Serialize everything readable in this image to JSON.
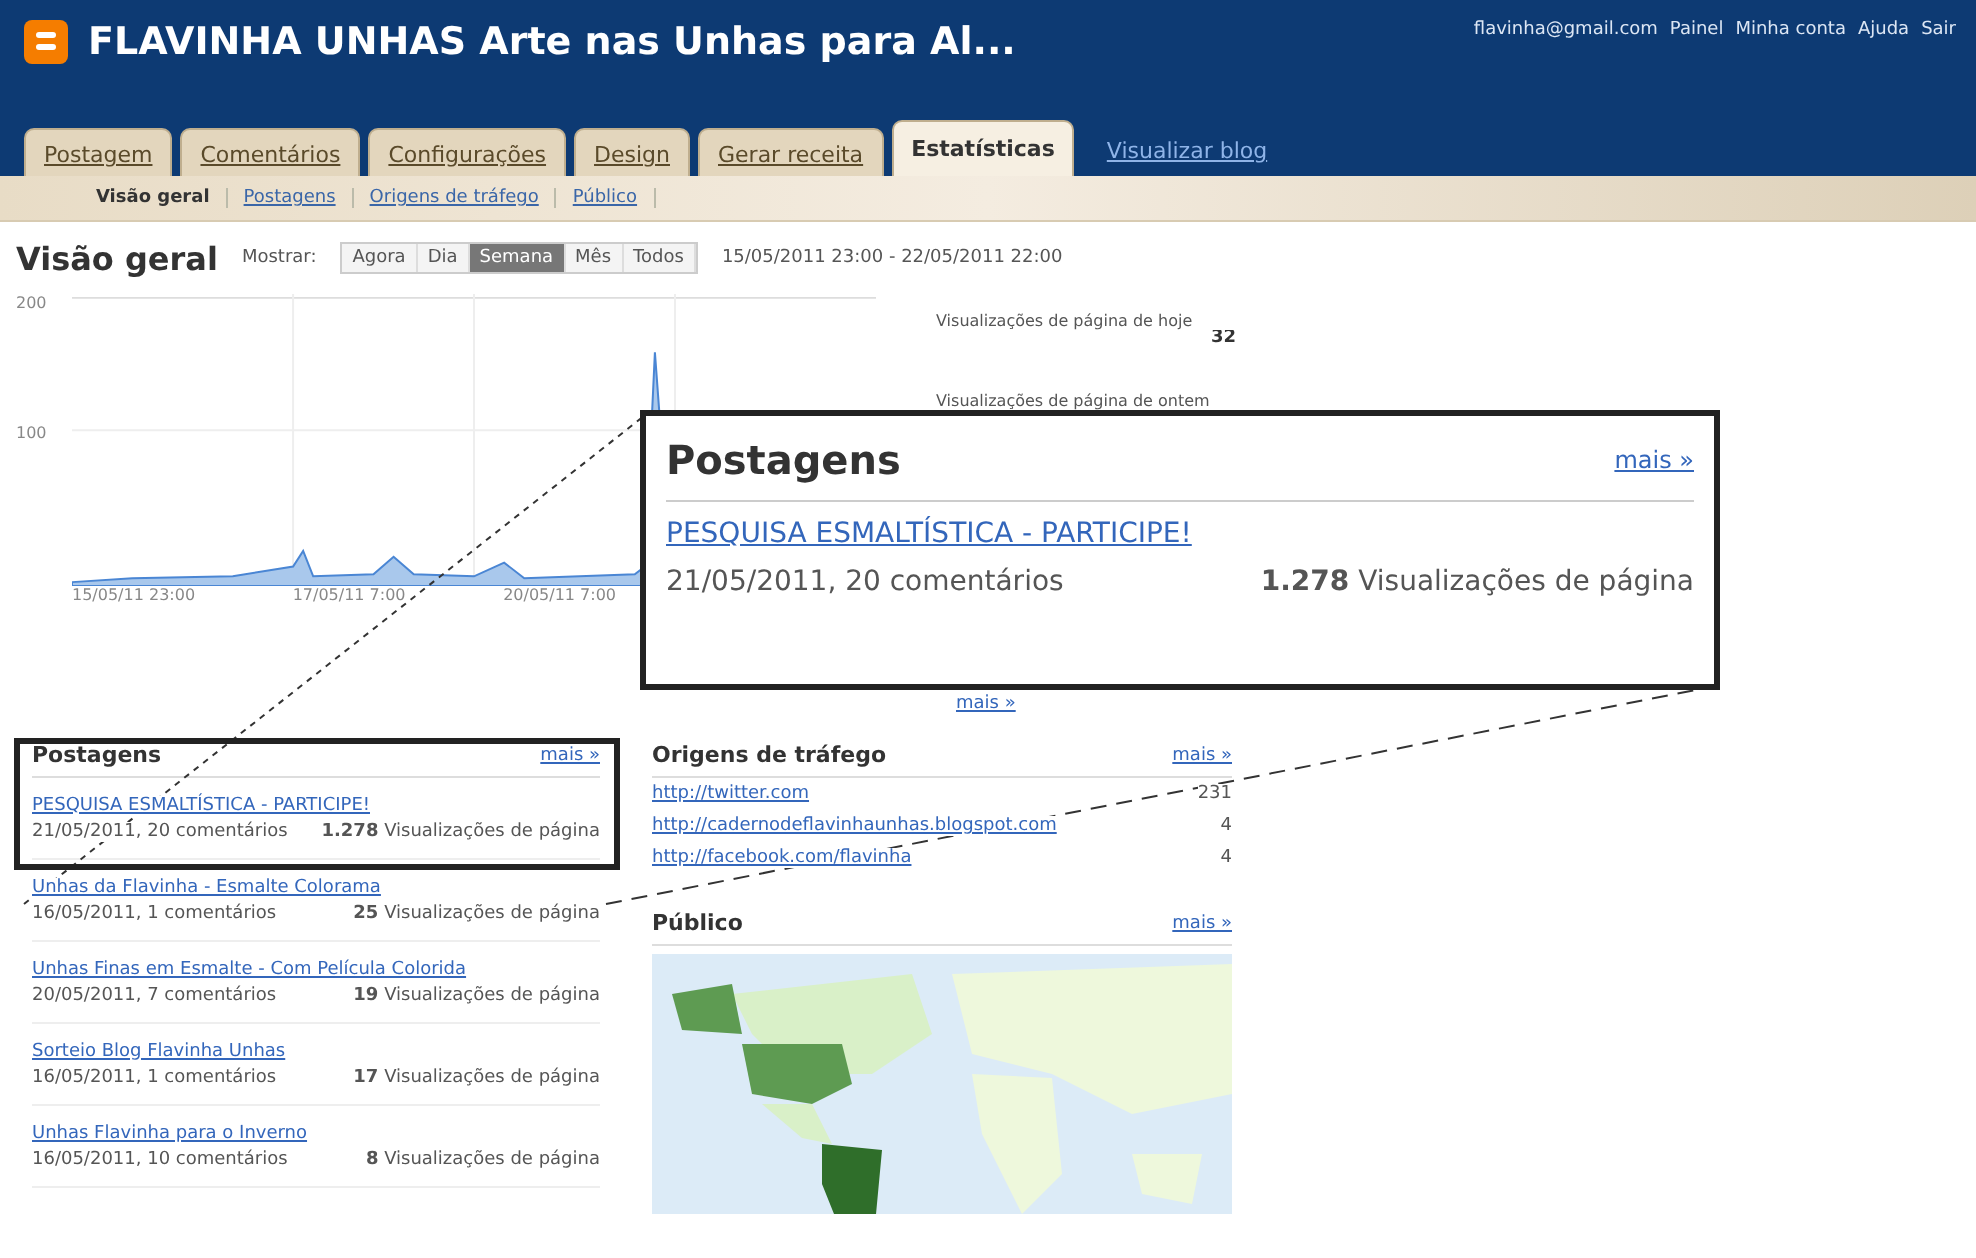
{
  "header": {
    "title": "FLAVINHA UNHAS Arte nas Unhas para Al...",
    "links": [
      "flavinha@gmail.com",
      "Painel",
      "Minha conta",
      "Ajuda",
      "Sair"
    ]
  },
  "tabs": [
    {
      "label": "Postagem",
      "selected": false
    },
    {
      "label": "Comentários",
      "selected": false
    },
    {
      "label": "Configurações",
      "selected": false
    },
    {
      "label": "Design",
      "selected": false
    },
    {
      "label": "Gerar receita",
      "selected": false
    },
    {
      "label": "Estatísticas",
      "selected": true
    }
  ],
  "view_blog_link": "Visualizar blog",
  "subtabs": [
    {
      "label": "Visão geral",
      "selected": true
    },
    {
      "label": "Postagens",
      "selected": false
    },
    {
      "label": "Origens de tráfego",
      "selected": false
    },
    {
      "label": "Público",
      "selected": false
    }
  ],
  "overview": {
    "title": "Visão geral",
    "show_label": "Mostrar:",
    "ranges": [
      {
        "label": "Agora",
        "selected": false
      },
      {
        "label": "Dia",
        "selected": false
      },
      {
        "label": "Semana",
        "selected": true
      },
      {
        "label": "Mês",
        "selected": false
      },
      {
        "label": "Todos",
        "selected": false
      }
    ],
    "date_range": "15/05/2011 23:00 - 22/05/2011 22:00"
  },
  "chart": {
    "y_labels": [
      "200",
      "100"
    ],
    "x_labels": [
      "15/05/11 23:00",
      "17/05/11 7:00",
      "20/05/11 7:00"
    ]
  },
  "stats": [
    {
      "label": "Visualizações de página de hoje",
      "value": "32"
    },
    {
      "label": "Visualizações de página de ontem"
    }
  ],
  "more_link": "mais »",
  "callout": {
    "title": "Postagens",
    "more": "mais »",
    "post": {
      "title": "PESQUISA ESMALTÍSTICA - PARTICIPE!",
      "meta": "21/05/2011, 20 comentários",
      "views": "1.278",
      "views_label": "Visualizações de página"
    }
  },
  "posts": {
    "title": "Postagens",
    "more": "mais »",
    "items": [
      {
        "title": "PESQUISA ESMALTÍSTICA - PARTICIPE!",
        "meta": "21/05/2011, 20 comentários",
        "views": "1.278",
        "views_label": "Visualizações de página"
      },
      {
        "title": "Unhas da Flavinha - Esmalte Colorama",
        "meta": "16/05/2011, 1 comentários",
        "views": "25",
        "views_label": "Visualizações de página"
      },
      {
        "title": "Unhas Finas em Esmalte - Com Película Colorida",
        "meta": "20/05/2011, 7 comentários",
        "views": "19",
        "views_label": "Visualizações de página"
      },
      {
        "title": "Sorteio Blog Flavinha Unhas",
        "meta": "16/05/2011, 1 comentários",
        "views": "17",
        "views_label": "Visualizações de página"
      },
      {
        "title": "Unhas Flavinha para o Inverno",
        "meta": "16/05/2011, 10 comentários",
        "views": "8",
        "views_label": "Visualizações de página"
      }
    ]
  },
  "traffic": {
    "title": "Origens de tráfego",
    "more": "mais »",
    "rows": [
      {
        "url": "http://twitter.com",
        "count": "231"
      },
      {
        "url": "http://cadernodeflavinhaunhas.blogspot.com",
        "count": "4"
      },
      {
        "url": "http://facebook.com/flavinha",
        "count": "4"
      }
    ]
  },
  "audience": {
    "title": "Público",
    "more": "mais »"
  }
}
